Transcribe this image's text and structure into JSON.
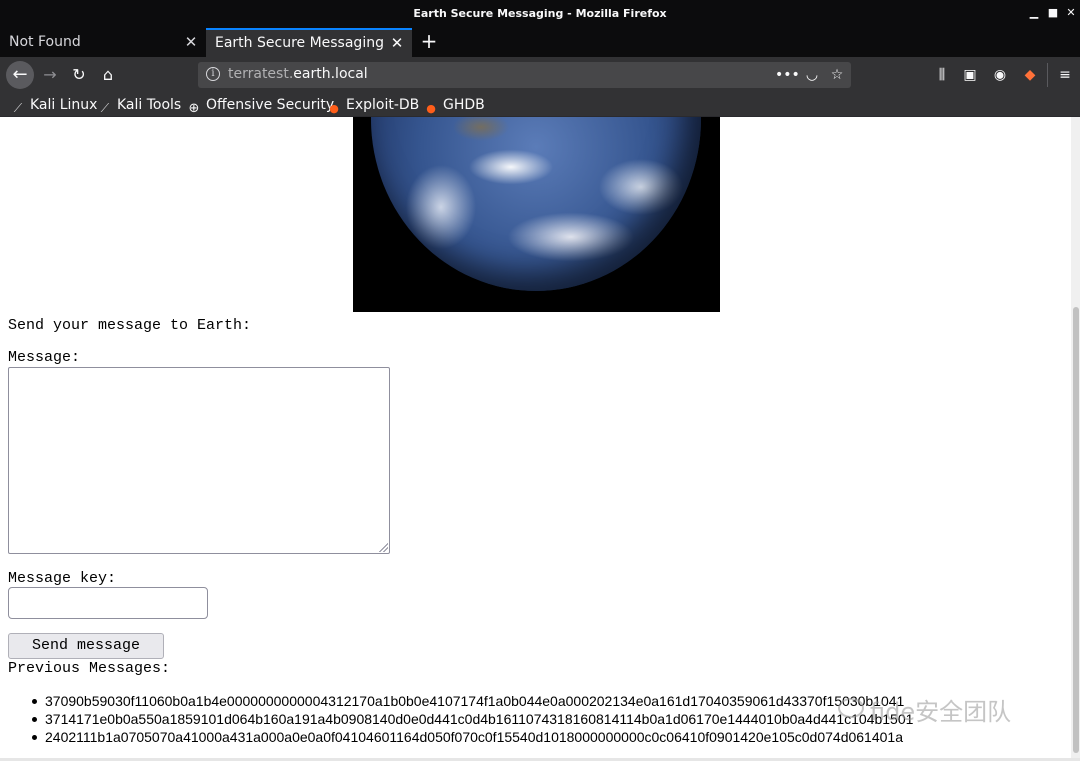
{
  "window": {
    "title": "Earth Secure Messaging - Mozilla Firefox"
  },
  "tabs": [
    {
      "label": "Not Found",
      "active": false
    },
    {
      "label": "Earth Secure Messaging",
      "active": true
    }
  ],
  "urlbar": {
    "host_prefix": "terratest.",
    "host_domain": "earth.local"
  },
  "bookmarks": [
    {
      "label": "Kali Linux",
      "icon": "kali-dragon-icon"
    },
    {
      "label": "Kali Tools",
      "icon": "kali-dragon-icon"
    },
    {
      "label": "Offensive Security",
      "icon": "globe-icon"
    },
    {
      "label": "Exploit-DB",
      "icon": "exploitdb-icon"
    },
    {
      "label": "GHDB",
      "icon": "ghdb-icon"
    }
  ],
  "page": {
    "send_heading": "Send your message to Earth:",
    "message_label": "Message:",
    "message_value": "",
    "key_label": "Message key:",
    "key_value": "",
    "send_button": "Send message",
    "previous_label": "Previous Messages:",
    "previous_messages": [
      "37090b59030f11060b0a1b4e0000000000004312170a1b0b0e4107174f1a0b044e0a000202134e0a161d17040359061d43370f15030b1041",
      "3714171e0b0a550a1859101d064b160a191a4b0908140d0e0d441c0d4b1611074318160814114b0a1d06170e1444010b0a4d441c104b1501",
      "2402111b1a0705070a41000a431a000a0e0a0f04104601164d050f070c0f15540d1018000000000c0c06410f0901420e105c0d074d061401a"
    ]
  },
  "watermark": {
    "text": "fide安全团队"
  },
  "colors": {
    "tab_accent": "#0a84ff",
    "chrome_dark": "#0c0c0d",
    "chrome_mid": "#323234"
  }
}
